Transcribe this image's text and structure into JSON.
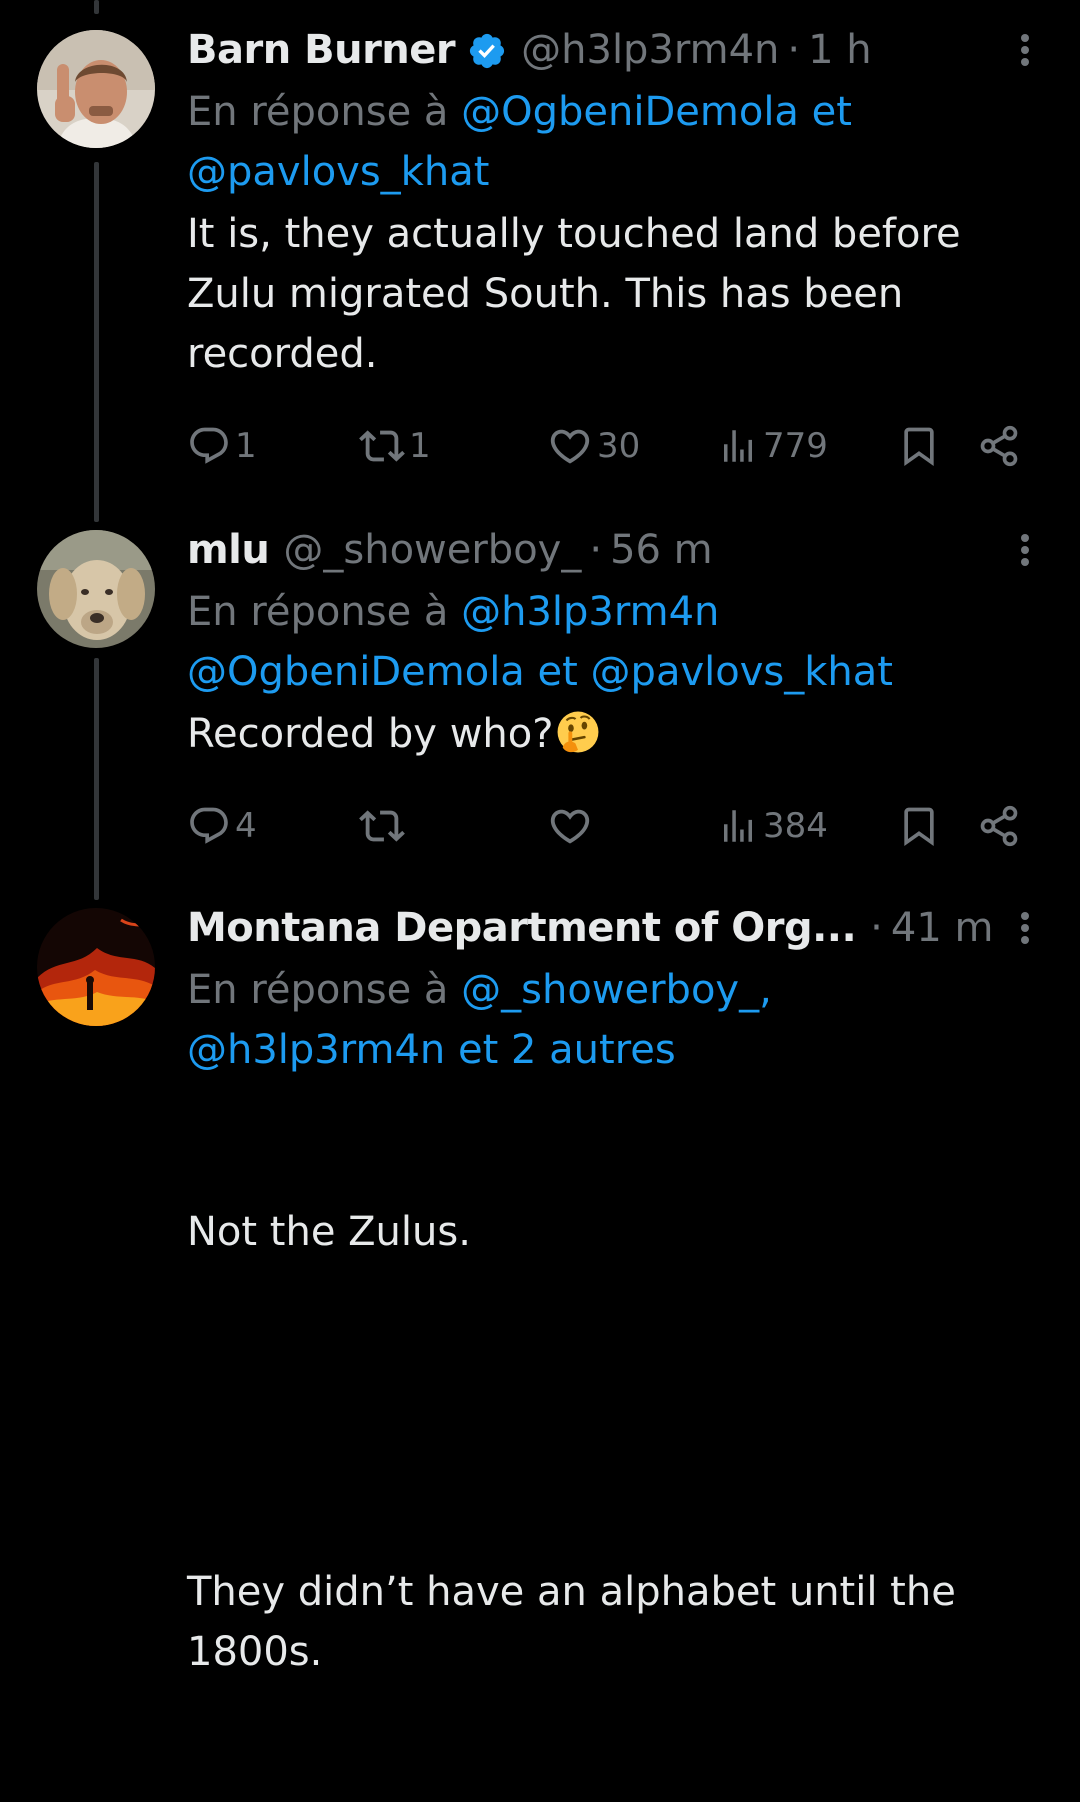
{
  "colors": {
    "background": "#000000",
    "text_primary": "#e7e9ea",
    "text_secondary": "#71767b",
    "link": "#1d9bf0",
    "verified": "#1d9bf0",
    "thread_line": "#333639"
  },
  "tweets": [
    {
      "display_name": "Barn Burner",
      "verified": true,
      "handle": "@h3lp3rm4n",
      "separator": "·",
      "time": "1 h",
      "reply_prefix": "En réponse à",
      "mentions": [
        "@OgbeniDemola",
        "@pavlovs_khat"
      ],
      "reply_joiner": "et",
      "body": "It is, they actually touched land before Zulu migrated South. This has been recorded.",
      "stats": {
        "replies": "1",
        "reposts": "1",
        "likes": "30",
        "views": "779"
      }
    },
    {
      "display_name": "mlu",
      "verified": false,
      "handle": "@_showerboy_",
      "separator": "·",
      "time": "56 m",
      "reply_prefix": "En réponse à",
      "mentions": [
        "@h3lp3rm4n",
        "@OgbeniDemola",
        "@pavlovs_khat"
      ],
      "reply_joiner": "et",
      "body": "Recorded by who?",
      "body_emoji": "thinking-face-emoji",
      "stats": {
        "replies": "4",
        "reposts": "",
        "likes": "",
        "views": "384"
      }
    },
    {
      "display_name": "Montana Department of Org...",
      "verified": false,
      "separator": "·",
      "time": "41 m",
      "reply_prefix": "En réponse à",
      "mentions": [
        "@_showerboy_,",
        "@h3lp3rm4n"
      ],
      "reply_joiner": "et",
      "reply_others": "2 autres",
      "body_p1": "Not the Zulus.",
      "body_p2": "They didn’t have an alphabet until the 1800s."
    }
  ],
  "icons": {
    "reply": "speech-bubble-icon",
    "repost": "repost-arrows-icon",
    "like": "heart-icon",
    "views": "bar-chart-icon",
    "bookmark": "bookmark-icon",
    "share": "share-icon",
    "more": "more-vertical-icon",
    "verified": "verified-badge-icon"
  }
}
